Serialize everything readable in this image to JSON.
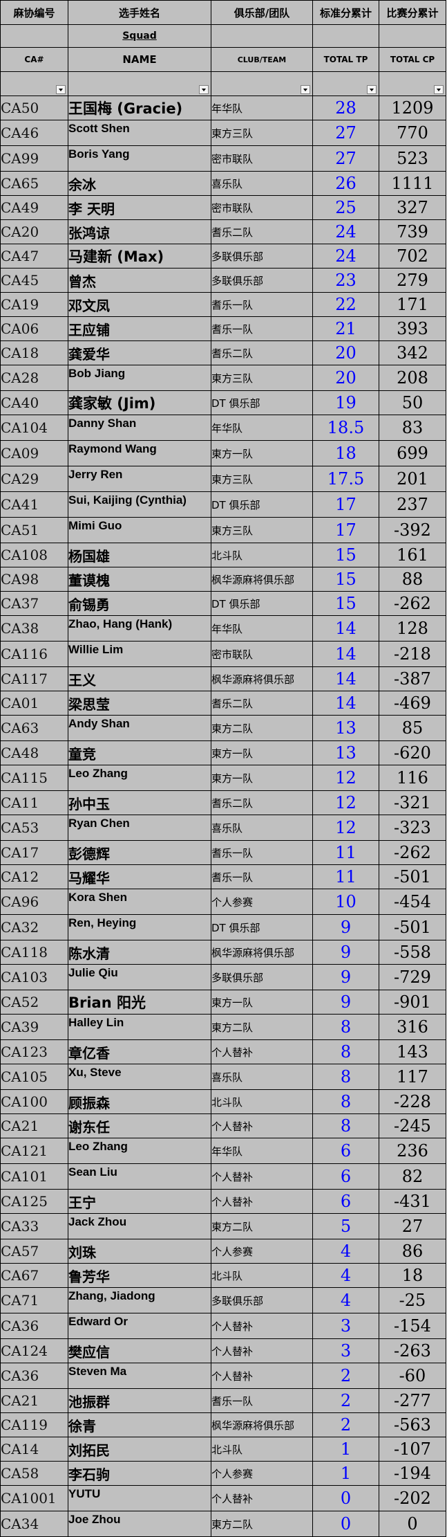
{
  "header": {
    "id_cn": "麻协编号",
    "name_cn": "选手姓名",
    "club_cn": "俱乐部/团队",
    "tp_cn": "标准分累计",
    "cp_cn": "比赛分累计",
    "squad": "Squad",
    "id_en": "CA#",
    "name_en": "NAME",
    "club_en": "CLUB/TEAM",
    "tp_en": "TOTAL TP",
    "cp_en": "TOTAL CP"
  },
  "colors": {
    "sheet_bg": "#c0c0c0",
    "tp_text": "#0000ff",
    "grid": "#000000"
  },
  "rows": [
    {
      "id": "CA50",
      "name": "王国梅 (Gracie)",
      "club": "年华队",
      "tp": "28",
      "cp": "1209"
    },
    {
      "id": "CA46",
      "name": "Scott Shen",
      "club": "東方三队",
      "tp": "27",
      "cp": "770"
    },
    {
      "id": "CA99",
      "name": "Boris Yang",
      "club": "密市联队",
      "tp": "27",
      "cp": "523"
    },
    {
      "id": "CA65",
      "name": "余冰",
      "club": "喜乐队",
      "tp": "26",
      "cp": "1111"
    },
    {
      "id": "CA49",
      "name": "李 天明",
      "club": "密市联队",
      "tp": "25",
      "cp": "327"
    },
    {
      "id": "CA20",
      "name": "张鸿谅",
      "club": "耆乐二队",
      "tp": "24",
      "cp": "739"
    },
    {
      "id": "CA47",
      "name": "马建新 (Max)",
      "club": "多联俱乐部",
      "tp": "24",
      "cp": "702"
    },
    {
      "id": "CA45",
      "name": "曾杰",
      "club": "多联俱乐部",
      "tp": "23",
      "cp": "279"
    },
    {
      "id": "CA19",
      "name": "邓文凤",
      "club": "耆乐一队",
      "tp": "22",
      "cp": "171"
    },
    {
      "id": "CA06",
      "name": "王应铺",
      "club": "耆乐一队",
      "tp": "21",
      "cp": "393"
    },
    {
      "id": "CA18",
      "name": "龚爱华",
      "club": "耆乐二队",
      "tp": "20",
      "cp": "342"
    },
    {
      "id": "CA28",
      "name": "Bob Jiang",
      "club": "東方三队",
      "tp": "20",
      "cp": "208"
    },
    {
      "id": "CA40",
      "name": "龚家敏 (Jim)",
      "club": "DT 俱乐部",
      "tp": "19",
      "cp": "50"
    },
    {
      "id": "CA104",
      "name": "Danny Shan",
      "club": "年华队",
      "tp": "18.5",
      "cp": "83"
    },
    {
      "id": "CA09",
      "name": "Raymond Wang",
      "club": "東方一队",
      "tp": "18",
      "cp": "699"
    },
    {
      "id": "CA29",
      "name": "Jerry Ren",
      "club": "東方三队",
      "tp": "17.5",
      "cp": "201"
    },
    {
      "id": "CA41",
      "name": "Sui, Kaijing (Cynthia)",
      "club": "DT 俱乐部",
      "tp": "17",
      "cp": "237"
    },
    {
      "id": "CA51",
      "name": "Mimi Guo",
      "club": "東方三队",
      "tp": "17",
      "cp": "-392"
    },
    {
      "id": "CA108",
      "name": "杨国雄",
      "club": "北斗队",
      "tp": "15",
      "cp": "161"
    },
    {
      "id": "CA98",
      "name": "董谟槐",
      "club": "枫华源麻将俱乐部",
      "tp": "15",
      "cp": "88"
    },
    {
      "id": "CA37",
      "name": "俞锡勇",
      "club": "DT 俱乐部",
      "tp": "15",
      "cp": "-262"
    },
    {
      "id": "CA38",
      "name": "Zhao, Hang (Hank)",
      "club": "年华队",
      "tp": "14",
      "cp": "128"
    },
    {
      "id": "CA116",
      "name": "Willie Lim",
      "club": "密市联队",
      "tp": "14",
      "cp": "-218"
    },
    {
      "id": "CA117",
      "name": "王义",
      "club": "枫华源麻将俱乐部",
      "tp": "14",
      "cp": "-387"
    },
    {
      "id": "CA01",
      "name": "梁思莹",
      "club": "耆乐二队",
      "tp": "14",
      "cp": "-469"
    },
    {
      "id": "CA63",
      "name": "Andy Shan",
      "club": "東方二队",
      "tp": "13",
      "cp": "85"
    },
    {
      "id": "CA48",
      "name": "童竞",
      "club": "東方一队",
      "tp": "13",
      "cp": "-620"
    },
    {
      "id": "CA115",
      "name": "Leo Zhang",
      "club": "東方一队",
      "tp": "12",
      "cp": "116"
    },
    {
      "id": "CA11",
      "name": "孙中玉",
      "club": "耆乐二队",
      "tp": "12",
      "cp": "-321"
    },
    {
      "id": "CA53",
      "name": "Ryan Chen",
      "club": "喜乐队",
      "tp": "12",
      "cp": "-323"
    },
    {
      "id": "CA17",
      "name": "彭德辉",
      "club": "耆乐一队",
      "tp": "11",
      "cp": "-262"
    },
    {
      "id": "CA12",
      "name": "马耀华",
      "club": "耆乐一队",
      "tp": "11",
      "cp": "-501"
    },
    {
      "id": "CA96",
      "name": "Kora Shen",
      "club": "个人参赛",
      "tp": "10",
      "cp": "-454"
    },
    {
      "id": "CA32",
      "name": "Ren, Heying",
      "club": "DT 俱乐部",
      "tp": "9",
      "cp": "-501"
    },
    {
      "id": "CA118",
      "name": "陈水清",
      "club": "枫华源麻将俱乐部",
      "tp": "9",
      "cp": "-558"
    },
    {
      "id": "CA103",
      "name": "Julie Qiu",
      "club": "多联俱乐部",
      "tp": "9",
      "cp": "-729"
    },
    {
      "id": "CA52",
      "name": "Brian 阳光",
      "club": "東方一队",
      "tp": "9",
      "cp": "-901"
    },
    {
      "id": "CA39",
      "name": "Halley Lin",
      "club": "東方二队",
      "tp": "8",
      "cp": "316"
    },
    {
      "id": "CA123",
      "name": "章亿香",
      "club": "个人替补",
      "tp": "8",
      "cp": "143"
    },
    {
      "id": "CA105",
      "name": "Xu, Steve",
      "club": "喜乐队",
      "tp": "8",
      "cp": "117"
    },
    {
      "id": "CA100",
      "name": "顾振森",
      "club": "北斗队",
      "tp": "8",
      "cp": "-228"
    },
    {
      "id": "CA21",
      "name": "谢东任",
      "club": "个人替补",
      "tp": "8",
      "cp": "-245"
    },
    {
      "id": "CA121",
      "name": "Leo Zhang",
      "club": "年华队",
      "tp": "6",
      "cp": "236"
    },
    {
      "id": "CA101",
      "name": "Sean Liu",
      "club": "个人替补",
      "tp": "6",
      "cp": "82"
    },
    {
      "id": "CA125",
      "name": "王宁",
      "club": "个人替补",
      "tp": "6",
      "cp": "-431"
    },
    {
      "id": "CA33",
      "name": "Jack Zhou",
      "club": "東方二队",
      "tp": "5",
      "cp": "27"
    },
    {
      "id": "CA57",
      "name": "刘珠",
      "club": "个人参赛",
      "tp": "4",
      "cp": "86"
    },
    {
      "id": "CA67",
      "name": "鲁芳华",
      "club": "北斗队",
      "tp": "4",
      "cp": "18"
    },
    {
      "id": "CA71",
      "name": "Zhang, Jiadong",
      "club": "多联俱乐部",
      "tp": "4",
      "cp": "-25"
    },
    {
      "id": "CA36",
      "name": "Edward Or",
      "club": "个人替补",
      "tp": "3",
      "cp": "-154"
    },
    {
      "id": "CA124",
      "name": "樊应信",
      "club": "个人替补",
      "tp": "3",
      "cp": "-263"
    },
    {
      "id": "CA36",
      "name": "Steven Ma",
      "club": "个人替补",
      "tp": "2",
      "cp": "-60"
    },
    {
      "id": "CA21",
      "name": "池振群",
      "club": "耆乐一队",
      "tp": "2",
      "cp": "-277"
    },
    {
      "id": "CA119",
      "name": "徐青",
      "club": "枫华源麻将俱乐部",
      "tp": "2",
      "cp": "-563"
    },
    {
      "id": "CA14",
      "name": "刘拓民",
      "club": "北斗队",
      "tp": "1",
      "cp": "-107"
    },
    {
      "id": "CA58",
      "name": "李石驹",
      "club": "个人参赛",
      "tp": "1",
      "cp": "-194"
    },
    {
      "id": "CA1001",
      "name": "YUTU",
      "club": "个人替补",
      "tp": "0",
      "cp": "-202"
    },
    {
      "id": "CA34",
      "name": "Joe Zhou",
      "club": "東方二队",
      "tp": "0",
      "cp": "0"
    }
  ]
}
